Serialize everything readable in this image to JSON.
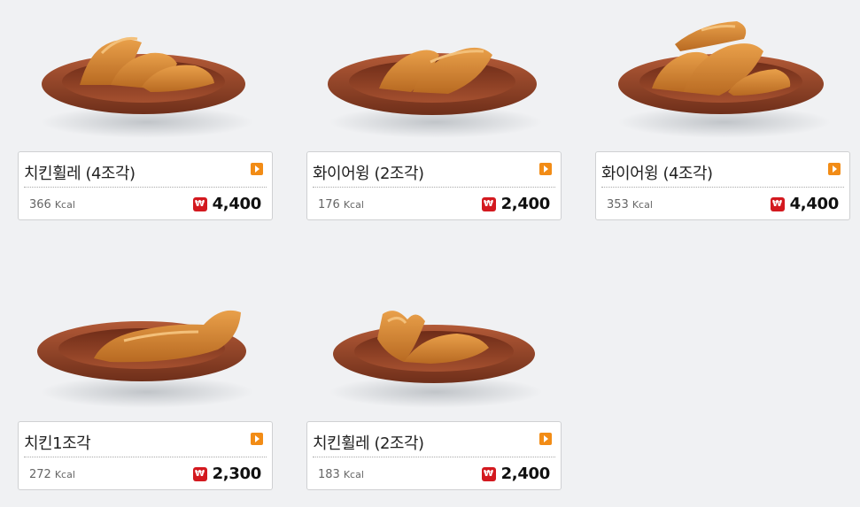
{
  "currency_icon": "won-icon",
  "colors": {
    "accent_orange": "#f28c16",
    "won_red": "#d3191f",
    "plate": "#9a4a2e"
  },
  "menu": [
    {
      "name": "치킨휠레 (4조각)",
      "kcal": "366",
      "kcal_unit": "Kcal",
      "price": "4,400",
      "image": "chicken-fillet-4pc"
    },
    {
      "name": "화이어윙 (2조각)",
      "kcal": "176",
      "kcal_unit": "Kcal",
      "price": "2,400",
      "image": "fire-wing-2pc"
    },
    {
      "name": "화이어윙 (4조각)",
      "kcal": "353",
      "kcal_unit": "Kcal",
      "price": "4,400",
      "image": "fire-wing-4pc"
    },
    {
      "name": "치킨1조각",
      "kcal": "272",
      "kcal_unit": "Kcal",
      "price": "2,300",
      "image": "chicken-1pc"
    },
    {
      "name": "치킨휠레 (2조각)",
      "kcal": "183",
      "kcal_unit": "Kcal",
      "price": "2,400",
      "image": "chicken-fillet-2pc"
    }
  ]
}
